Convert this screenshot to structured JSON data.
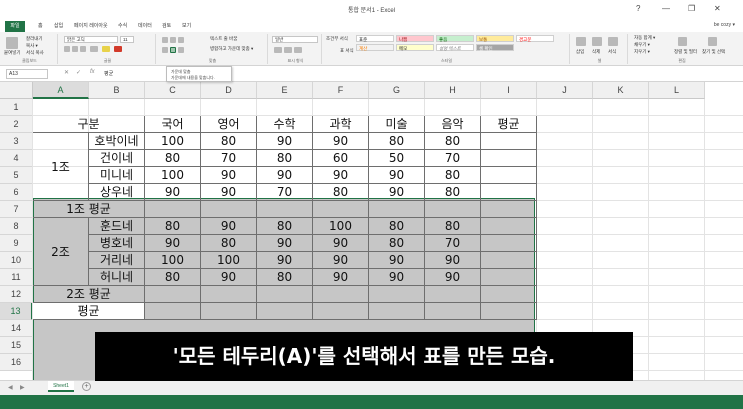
{
  "window": {
    "title": "통합 문서1 - Excel",
    "help_label": "?",
    "minimize_label": "—",
    "restore_label": "❐",
    "close_label": "✕"
  },
  "tabs": {
    "file": "파일",
    "items": [
      "홈",
      "삽입",
      "페이지 레이아웃",
      "수식",
      "데이터",
      "검토",
      "보기"
    ],
    "user": "be cozy ▾"
  },
  "ribbon": {
    "paste_label": "붙여넣기",
    "cut_label": "잘라내기",
    "copy_label": "복사 ▾",
    "format_painter_label": "서식 복사",
    "clipboard_group": "클립보드",
    "font_name": "맑은 고딕",
    "font_size": "11",
    "font_group": "글꼴",
    "wrap_text": "텍스트 줄 바꿈",
    "merge_center": "병합하고 가운데 맞춤 ▾",
    "align_group": "맞춤",
    "number_format": "일반",
    "number_group": "표시 형식",
    "cond_format": "조건부 서식",
    "table_format": "표 서식",
    "cell_style": "셀 스타일",
    "styles": {
      "standard": "표준",
      "bad": "나쁨",
      "good": "좋음",
      "neutral": "보통",
      "calc": "계산",
      "check_cell": "셀 확인",
      "note": "메모",
      "explanatory": "설명 텍스트",
      "warning": "경고문"
    },
    "styles_group": "스타일",
    "insert": "삽입",
    "delete": "삭제",
    "format": "서식",
    "cells_group": "셀",
    "autosum": "자동 합계 ▾",
    "fill": "채우기 ▾",
    "clear": "지우기 ▾",
    "sort_filter": "정렬 및 필터",
    "find_select": "찾기 및 선택",
    "editing_group": "편집"
  },
  "tooltip": {
    "title": "가운데 맞춤",
    "desc": "가운데에 내용을 맞춥니다."
  },
  "formula_bar": {
    "name_box": "A13",
    "fx_label": "fx",
    "cancel_label": "✕",
    "enter_label": "✓",
    "value": "평균"
  },
  "grid": {
    "columns": [
      "A",
      "B",
      "C",
      "D",
      "E",
      "F",
      "G",
      "H",
      "I",
      "J",
      "K",
      "L"
    ],
    "rows": [
      "1",
      "2",
      "3",
      "4",
      "5",
      "6",
      "7",
      "8",
      "9",
      "10",
      "11",
      "12",
      "13",
      "14",
      "15",
      "16"
    ],
    "header_row": [
      "구분",
      "국어",
      "영어",
      "수학",
      "과학",
      "미술",
      "음악",
      "평균"
    ],
    "group1": {
      "label": "1조",
      "rows": [
        {
          "name": "호박이네",
          "scores": [
            "100",
            "80",
            "90",
            "90",
            "80",
            "80"
          ]
        },
        {
          "name": "건이네",
          "scores": [
            "80",
            "70",
            "80",
            "60",
            "50",
            "70"
          ]
        },
        {
          "name": "미니네",
          "scores": [
            "100",
            "90",
            "90",
            "90",
            "90",
            "80"
          ]
        },
        {
          "name": "상우네",
          "scores": [
            "90",
            "90",
            "70",
            "80",
            "90",
            "80"
          ]
        }
      ],
      "avg_label": "1조 평균"
    },
    "group2": {
      "label": "2조",
      "rows": [
        {
          "name": "훈드네",
          "scores": [
            "80",
            "90",
            "80",
            "100",
            "80",
            "80"
          ]
        },
        {
          "name": "병호네",
          "scores": [
            "90",
            "80",
            "90",
            "90",
            "80",
            "70"
          ]
        },
        {
          "name": "거리네",
          "scores": [
            "100",
            "100",
            "90",
            "90",
            "90",
            "90"
          ]
        },
        {
          "name": "허니네",
          "scores": [
            "80",
            "90",
            "80",
            "90",
            "90",
            "90"
          ]
        }
      ],
      "avg_label": "2조 평균"
    },
    "overall_avg_label": "평균"
  },
  "caption": "'모든 테두리(A)'를 선택해서 표를 만든 모습.",
  "sheets": {
    "tab": "Sheet1",
    "add_label": "+"
  },
  "colors": {
    "excel_green": "#217346",
    "selection_fill": "#c6c6c6"
  }
}
